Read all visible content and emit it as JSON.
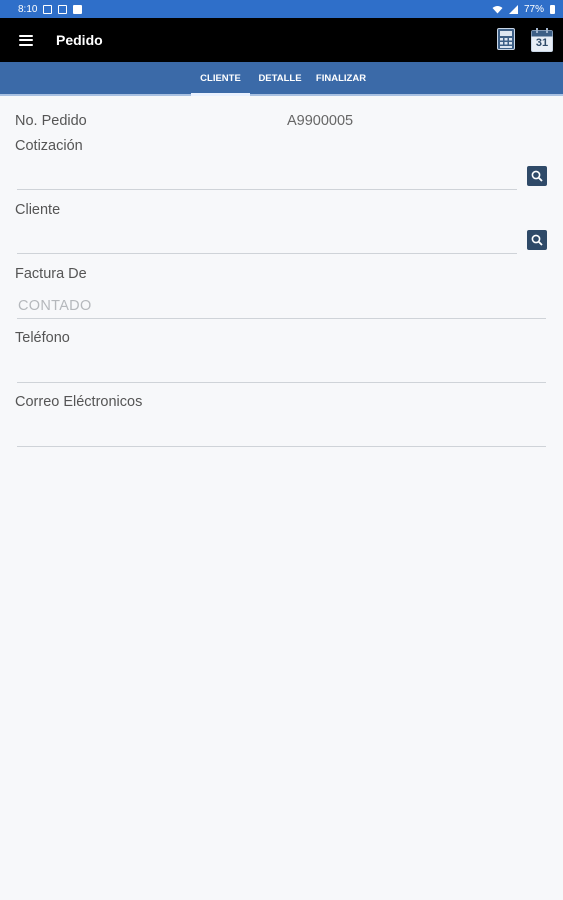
{
  "status_bar": {
    "time": "8:10",
    "battery": "77%"
  },
  "app_bar": {
    "title": "Pedido",
    "calendar_day": "31"
  },
  "tabs": [
    {
      "label": "CLIENTE",
      "active": true
    },
    {
      "label": "DETALLE",
      "active": false
    },
    {
      "label": "FINALIZAR",
      "active": false
    }
  ],
  "form": {
    "pedido_label": "No. Pedido",
    "pedido_value": "A9900005",
    "cotizacion_label": "Cotización",
    "cotizacion_value": "",
    "cliente_label": "Cliente",
    "cliente_value": "",
    "factura_label": "Factura De",
    "factura_placeholder": "CONTADO",
    "telefono_label": "Teléfono",
    "telefono_value": "",
    "correo_label": "Correo Eléctronicos",
    "correo_value": ""
  },
  "colors": {
    "status_bar": "#2f6fc9",
    "app_bar": "#000000",
    "tab_bar": "#3b6aa8",
    "search_button": "#2f4a68",
    "background": "#f7f8fa"
  }
}
